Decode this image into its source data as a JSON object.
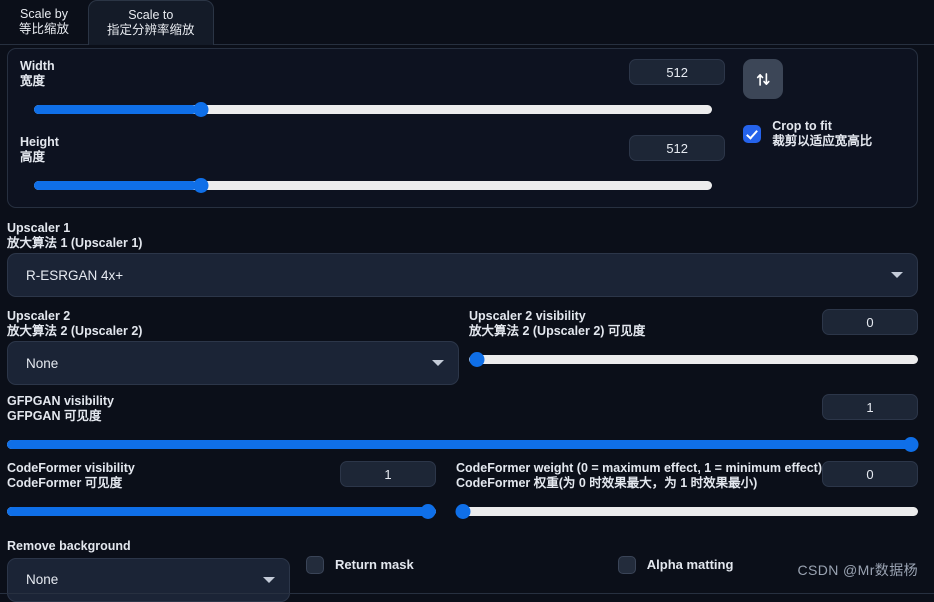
{
  "tabs": [
    {
      "id": "scale-by",
      "en": "Scale by",
      "cn": "等比缩放",
      "active": false
    },
    {
      "id": "scale-to",
      "en": "Scale to",
      "cn": "指定分辨率缩放",
      "active": true
    }
  ],
  "resize_panel": {
    "width": {
      "label_en": "Width",
      "label_cn": "宽度",
      "value": "512",
      "slider_percent": 24
    },
    "height": {
      "label_en": "Height",
      "label_cn": "高度",
      "value": "512",
      "slider_percent": 24
    },
    "swap_icon": "swap-vertical-icon",
    "crop_to_fit": {
      "label_en": "Crop to fit",
      "label_cn": "裁剪以适应宽高比",
      "checked": true
    }
  },
  "upscaler1": {
    "label_en": "Upscaler 1",
    "label_cn": "放大算法 1 (Upscaler 1)",
    "value": "R-ESRGAN 4x+"
  },
  "upscaler2": {
    "label_en": "Upscaler 2",
    "label_cn": "放大算法 2 (Upscaler 2)",
    "value": "None"
  },
  "upscaler2_visibility": {
    "label_en": "Upscaler 2 visibility",
    "label_cn": "放大算法 2 (Upscaler 2) 可见度",
    "value": "0",
    "slider_percent": 0
  },
  "gfpgan_visibility": {
    "label_en": "GFPGAN visibility",
    "label_cn": "GFPGAN 可见度",
    "value": "1",
    "slider_percent": 100
  },
  "codeformer_visibility": {
    "label_en": "CodeFormer visibility",
    "label_cn": "CodeFormer 可见度",
    "value": "1",
    "slider_percent": 100
  },
  "codeformer_weight": {
    "label_en": "CodeFormer weight (0 = maximum effect, 1 = minimum effect)",
    "label_cn": "CodeFormer 权重(为 0 时效果最大，为 1 时效果最小)",
    "value": "0",
    "slider_percent": 0
  },
  "remove_background": {
    "label": "Remove background",
    "value": "None"
  },
  "return_mask": {
    "label": "Return mask",
    "checked": false
  },
  "alpha_matting": {
    "label": "Alpha matting",
    "checked": false
  },
  "watermark": "CSDN @Mr数据杨",
  "colors": {
    "background": "#0b0f19",
    "panel": "#0d1220",
    "accent": "#0f6fe8",
    "checkbox_on": "#2563eb",
    "slider_track": "#ececed",
    "field": "#1d2636",
    "border": "#273040",
    "text": "#e3e7ee"
  }
}
